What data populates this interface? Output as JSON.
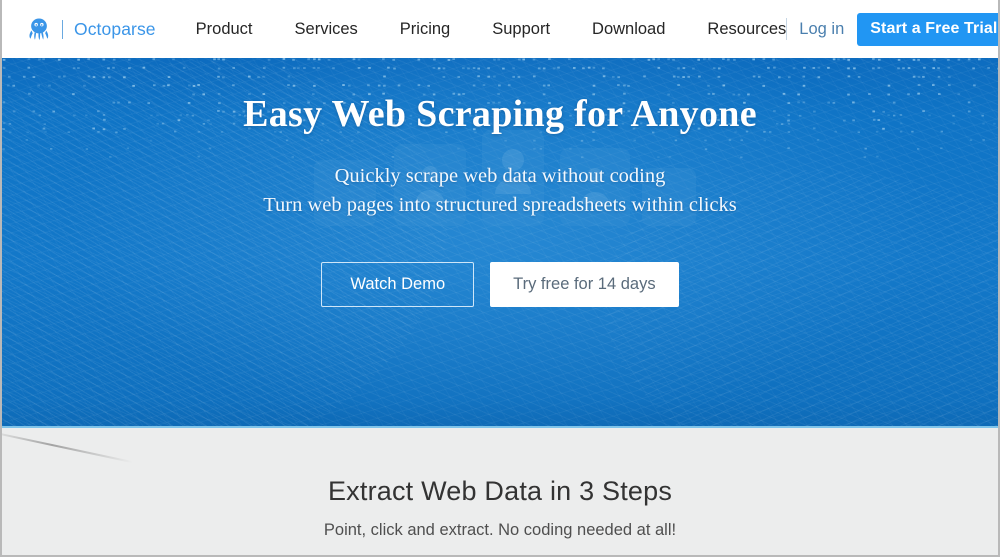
{
  "nav": {
    "logo_icon": "octopus-logo-icon",
    "brand": "Octoparse",
    "links": [
      {
        "label": "Product"
      },
      {
        "label": "Services"
      },
      {
        "label": "Pricing"
      },
      {
        "label": "Support"
      },
      {
        "label": "Download"
      },
      {
        "label": "Resources"
      }
    ],
    "login_label": "Log in",
    "trial_label": "Start a Free Trial",
    "language_icon": "globe-icon"
  },
  "hero": {
    "title": "Easy Web Scraping for Anyone",
    "subtitle_line1": "Quickly scrape web data without coding",
    "subtitle_line2": "Turn web pages into structured spreadsheets within clicks",
    "demo_button": "Watch Demo",
    "trial_button": "Try free for 14 days"
  },
  "steps": {
    "title": "Extract Web Data in 3 Steps",
    "subtitle": "Point, click and extract. No coding needed at all!"
  },
  "colors": {
    "brand_blue": "#3a95e8",
    "button_blue": "#2196f3",
    "hero_blue": "#1378c9",
    "section_gray": "#eceded",
    "hero_edge_line": "#7fc4ea"
  }
}
